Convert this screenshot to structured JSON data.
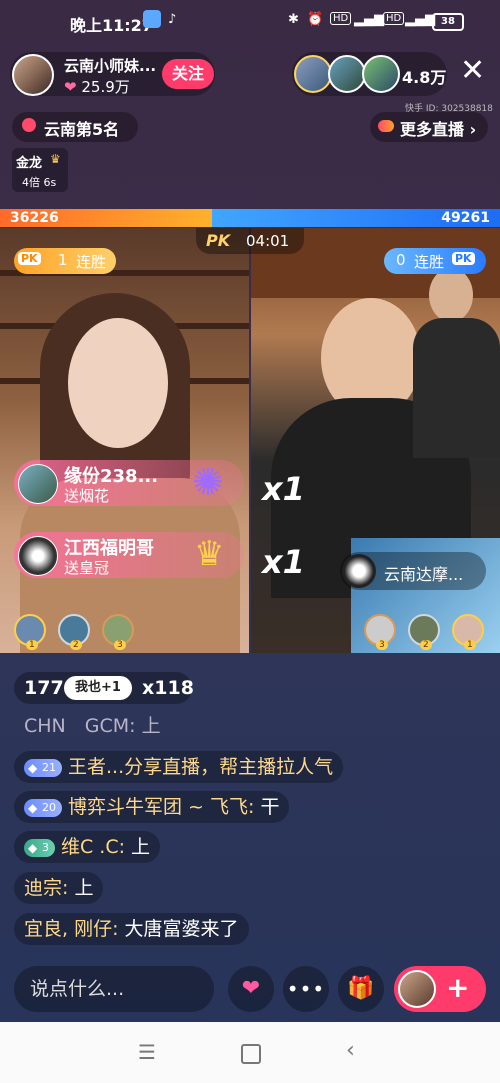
{
  "status": {
    "time": "晚上11:27",
    "battery": "38",
    "icons": [
      "bluetooth-icon",
      "alarm-icon",
      "hd-icon",
      "signal-icon",
      "wifi-icon"
    ]
  },
  "host": {
    "name": "云南小师妹...",
    "likes": "25.9万",
    "follow_label": "关注"
  },
  "viewers": {
    "count": "4.8万"
  },
  "kuaishou_id": "快手 ID: 302538818",
  "rank": {
    "label": "云南第5名"
  },
  "more_live": {
    "label": "更多直播 ›"
  },
  "badge": {
    "title": "金龙",
    "sub": "4倍 6s"
  },
  "pk": {
    "left_score": "36226",
    "right_score": "49261",
    "left_ratio": 0.424,
    "timer": "04:01",
    "pk_label": "PK",
    "left_streak_num": "1",
    "right_streak_num": "0",
    "streak_label": "连胜",
    "right_streak_label": "连胜"
  },
  "gifts": [
    {
      "name": "缘份238...",
      "action": "送烟花",
      "count": "x1"
    },
    {
      "name": "江西福明哥",
      "action": "送皇冠",
      "count": "x1"
    }
  ],
  "right_host": {
    "name": "云南达摩..."
  },
  "left_ranks": [
    "1",
    "2",
    "3"
  ],
  "right_ranks": [
    "3",
    "2",
    "1"
  ],
  "combo": {
    "count": "177",
    "button": "我也+1",
    "times": "x118"
  },
  "chat": [
    {
      "level": "",
      "user": "CHN　GCM:",
      "text": " 上"
    },
    {
      "level": "21",
      "user": "王者...分享直播，帮主播拉人气",
      "text": ""
    },
    {
      "level": "20",
      "user": "博弈斗牛军团 ~ 飞飞:",
      "text": " 干"
    },
    {
      "level": "3",
      "user": "维C .C:",
      "text": " 上"
    },
    {
      "level": "",
      "user": "迪宗:",
      "text": " 上"
    },
    {
      "level": "",
      "user": "宜良, 刚仔:",
      "text": " 大唐富婆来了"
    }
  ],
  "input": {
    "placeholder": "说点什么..."
  },
  "colors": {
    "accent": "#ff3b6b",
    "pk_left": "#ff8a2a",
    "pk_right": "#2a7bff"
  }
}
